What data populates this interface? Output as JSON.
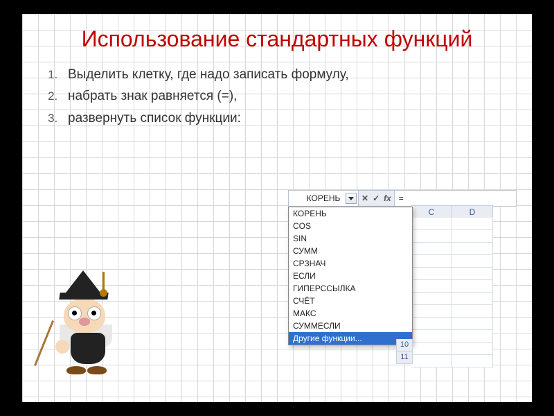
{
  "title": "Использование стандартных функций",
  "steps": [
    "Выделить клетку, где надо записать формулу,",
    "набрать знак равняется (=),",
    "развернуть список функции:"
  ],
  "excel": {
    "namebox": "КОРЕНЬ",
    "formula": "=",
    "columns": [
      "C",
      "D"
    ],
    "rownums": [
      "10",
      "11"
    ],
    "icons": {
      "cancel": "✕",
      "confirm": "✓",
      "fx": "fx"
    },
    "functions": [
      "КОРЕНЬ",
      "COS",
      "SIN",
      "СУММ",
      "СРЗНАЧ",
      "ЕСЛИ",
      "ГИПЕРССЫЛКА",
      "СЧЁТ",
      "МАКС",
      "СУММЕСЛИ",
      "Другие функции..."
    ],
    "selected_index": 10
  }
}
